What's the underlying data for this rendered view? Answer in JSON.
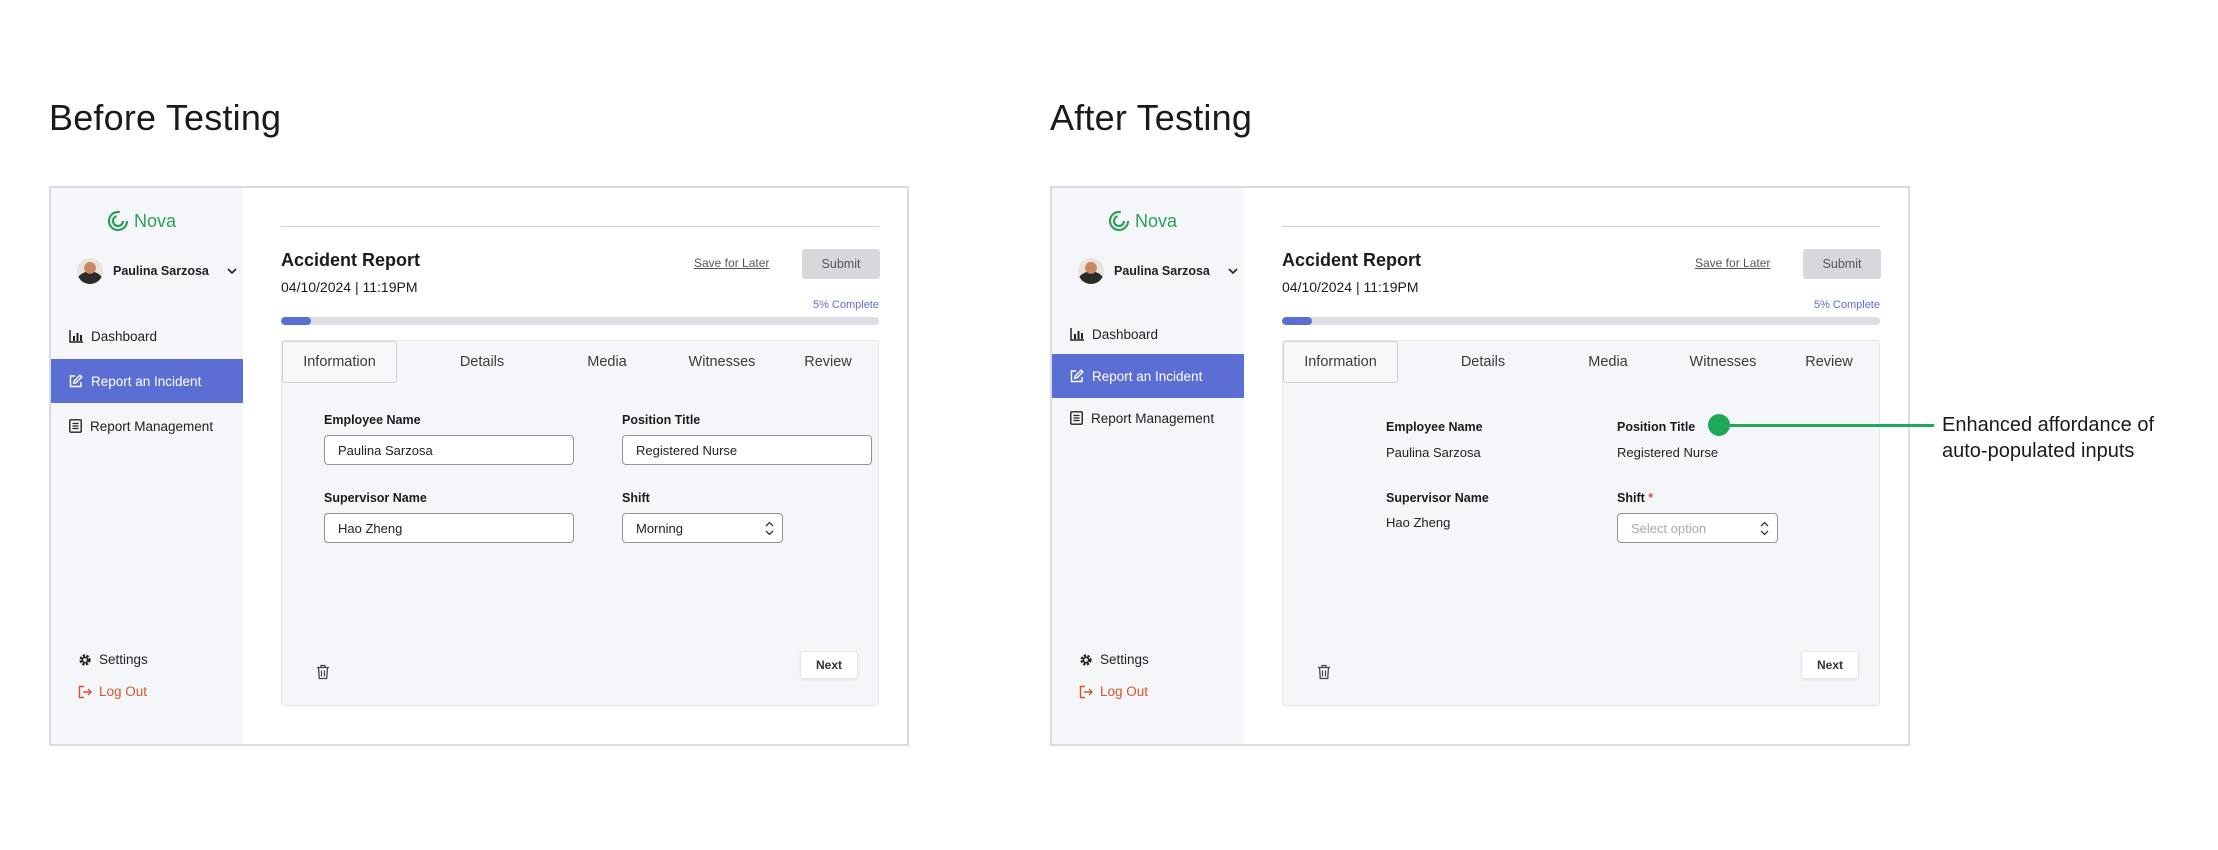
{
  "panels": [
    {
      "heading": "Before Testing",
      "app": {
        "logo_text": "Nova",
        "user_name": "Paulina Sarzosa",
        "nav": [
          {
            "label": "Dashboard",
            "icon": "bar-chart-icon"
          },
          {
            "label": "Report an Incident",
            "icon": "edit-icon",
            "active": true
          },
          {
            "label": "Report Management",
            "icon": "list-icon"
          }
        ],
        "settings_label": "Settings",
        "logout_label": "Log Out",
        "report_title": "Accident Report",
        "report_date": "04/10/2024 | 11:19PM",
        "save_later_label": "Save for Later",
        "submit_label": "Submit",
        "progress_label": "5% Complete",
        "progress_percent": 5,
        "tabs": [
          "Information",
          "Details",
          "Media",
          "Witnesses",
          "Review"
        ],
        "active_tab": "Information",
        "fields": {
          "employee_name_label": "Employee Name",
          "employee_name_value": "Paulina Sarzosa",
          "position_title_label": "Position Title",
          "position_title_value": "Registered Nurse",
          "supervisor_name_label": "Supervisor Name",
          "supervisor_name_value": "Hao Zheng",
          "shift_label": "Shift",
          "shift_value": "Morning"
        },
        "next_label": "Next"
      }
    },
    {
      "heading": "After Testing",
      "app": {
        "logo_text": "Nova",
        "user_name": "Paulina Sarzosa",
        "nav": [
          {
            "label": "Dashboard",
            "icon": "bar-chart-icon"
          },
          {
            "label": "Report an Incident",
            "icon": "edit-icon",
            "active": true
          },
          {
            "label": "Report Management",
            "icon": "list-icon"
          }
        ],
        "settings_label": "Settings",
        "logout_label": "Log Out",
        "report_title": "Accident Report",
        "report_date": "04/10/2024 | 11:19PM",
        "save_later_label": "Save for Later",
        "submit_label": "Submit",
        "progress_label": "5% Complete",
        "progress_percent": 5,
        "tabs": [
          "Information",
          "Details",
          "Media",
          "Witnesses",
          "Review"
        ],
        "active_tab": "Information",
        "fields": {
          "employee_name_label": "Employee Name",
          "employee_name_value": "Paulina Sarzosa",
          "position_title_label": "Position Title",
          "position_title_value": "Registered Nurse",
          "supervisor_name_label": "Supervisor Name",
          "supervisor_name_value": "Hao Zheng",
          "shift_label": "Shift",
          "shift_required_mark": "*",
          "shift_placeholder": "Select option"
        },
        "next_label": "Next"
      }
    }
  ],
  "callout": {
    "line1": "Enhanced affordance of",
    "line2": "auto-populated inputs",
    "color": "#1fa85a"
  },
  "colors": {
    "accent": "#5b6ed4",
    "brand_green": "#2e9e5a",
    "logout_red": "#d9532f",
    "sidebar_bg": "#f4f6fa"
  }
}
